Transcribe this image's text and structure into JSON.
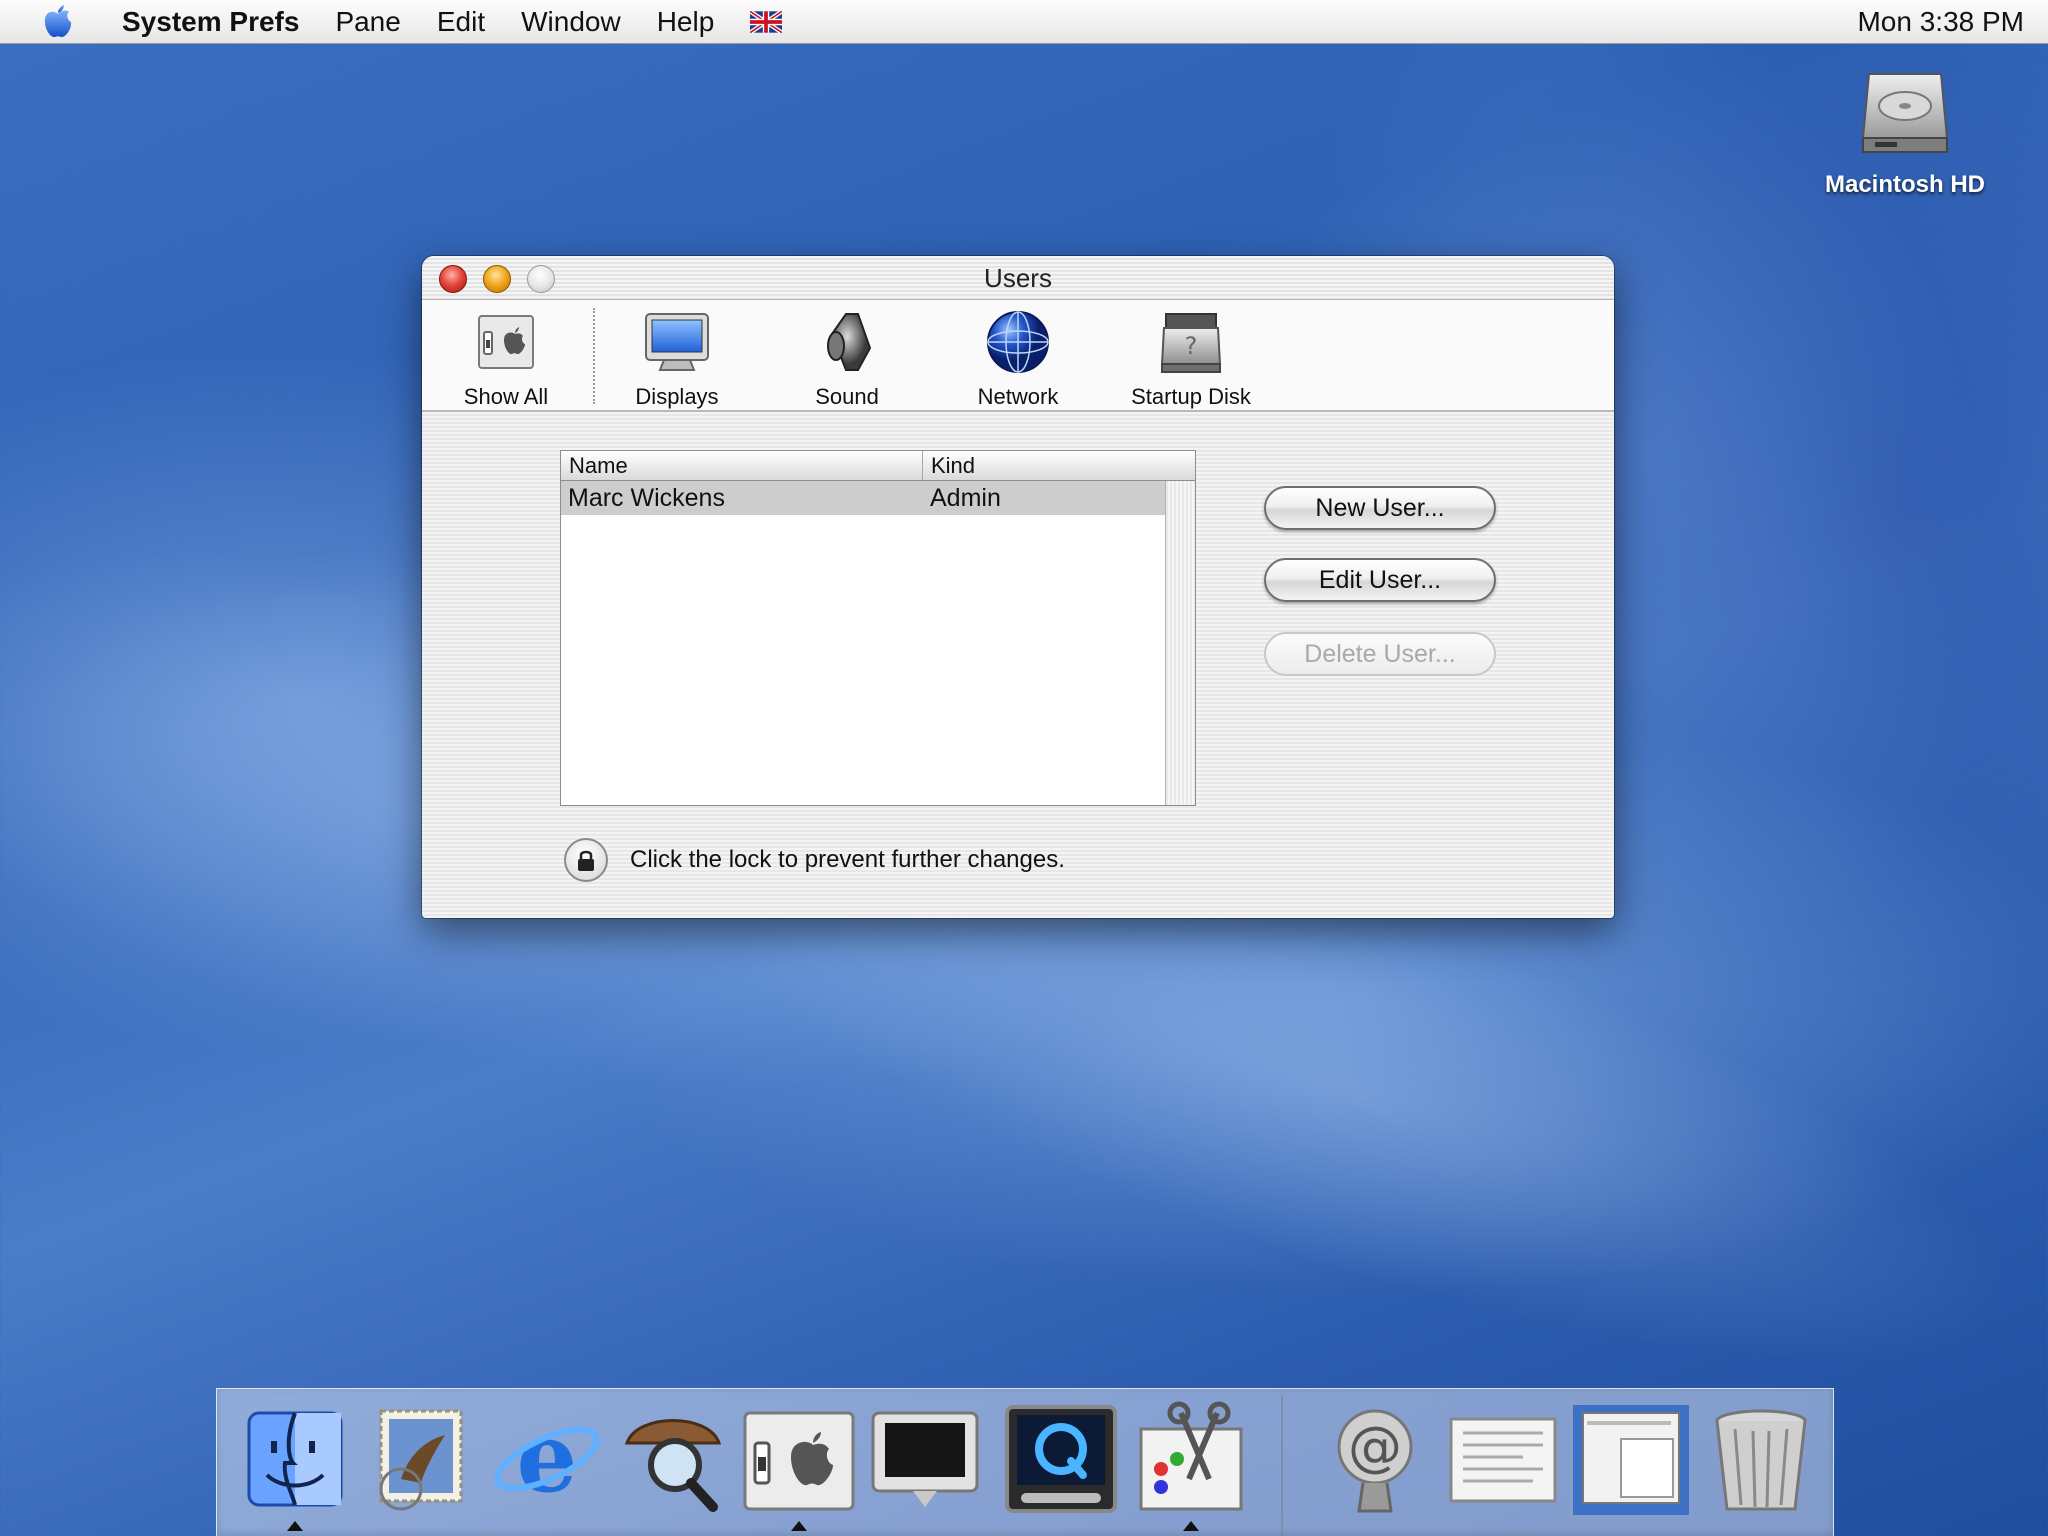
{
  "menubar": {
    "app_name": "System Prefs",
    "items": [
      "Pane",
      "Edit",
      "Window",
      "Help"
    ],
    "clock": "Mon 3:38 PM"
  },
  "desktop": {
    "hd_label": "Macintosh HD"
  },
  "window": {
    "title": "Users",
    "toolbar": [
      {
        "label": "Show All",
        "icon": "show-all-icon"
      },
      {
        "label": "Displays",
        "icon": "displays-icon"
      },
      {
        "label": "Sound",
        "icon": "sound-icon"
      },
      {
        "label": "Network",
        "icon": "network-icon"
      },
      {
        "label": "Startup Disk",
        "icon": "startup-disk-icon"
      }
    ],
    "table": {
      "columns": [
        "Name",
        "Kind"
      ],
      "rows": [
        {
          "name": "Marc Wickens",
          "kind": "Admin"
        }
      ]
    },
    "buttons": {
      "new_user": "New User...",
      "edit_user": "Edit User...",
      "delete_user": "Delete User..."
    },
    "lock_text": "Click the lock to prevent further changes."
  },
  "dock": {
    "items": [
      "finder-icon",
      "mail-icon",
      "internet-explorer-icon",
      "sherlock-icon",
      "system-preferences-icon",
      "monitor-icon",
      "quicktime-icon",
      "graphics-app-icon",
      "mail-at-icon",
      "document-icon",
      "window-thumbnail-icon",
      "trash-icon"
    ]
  },
  "colors": {
    "desktop": "#3b6ec0",
    "close": "#e2483b",
    "minimize": "#f2a91d"
  }
}
